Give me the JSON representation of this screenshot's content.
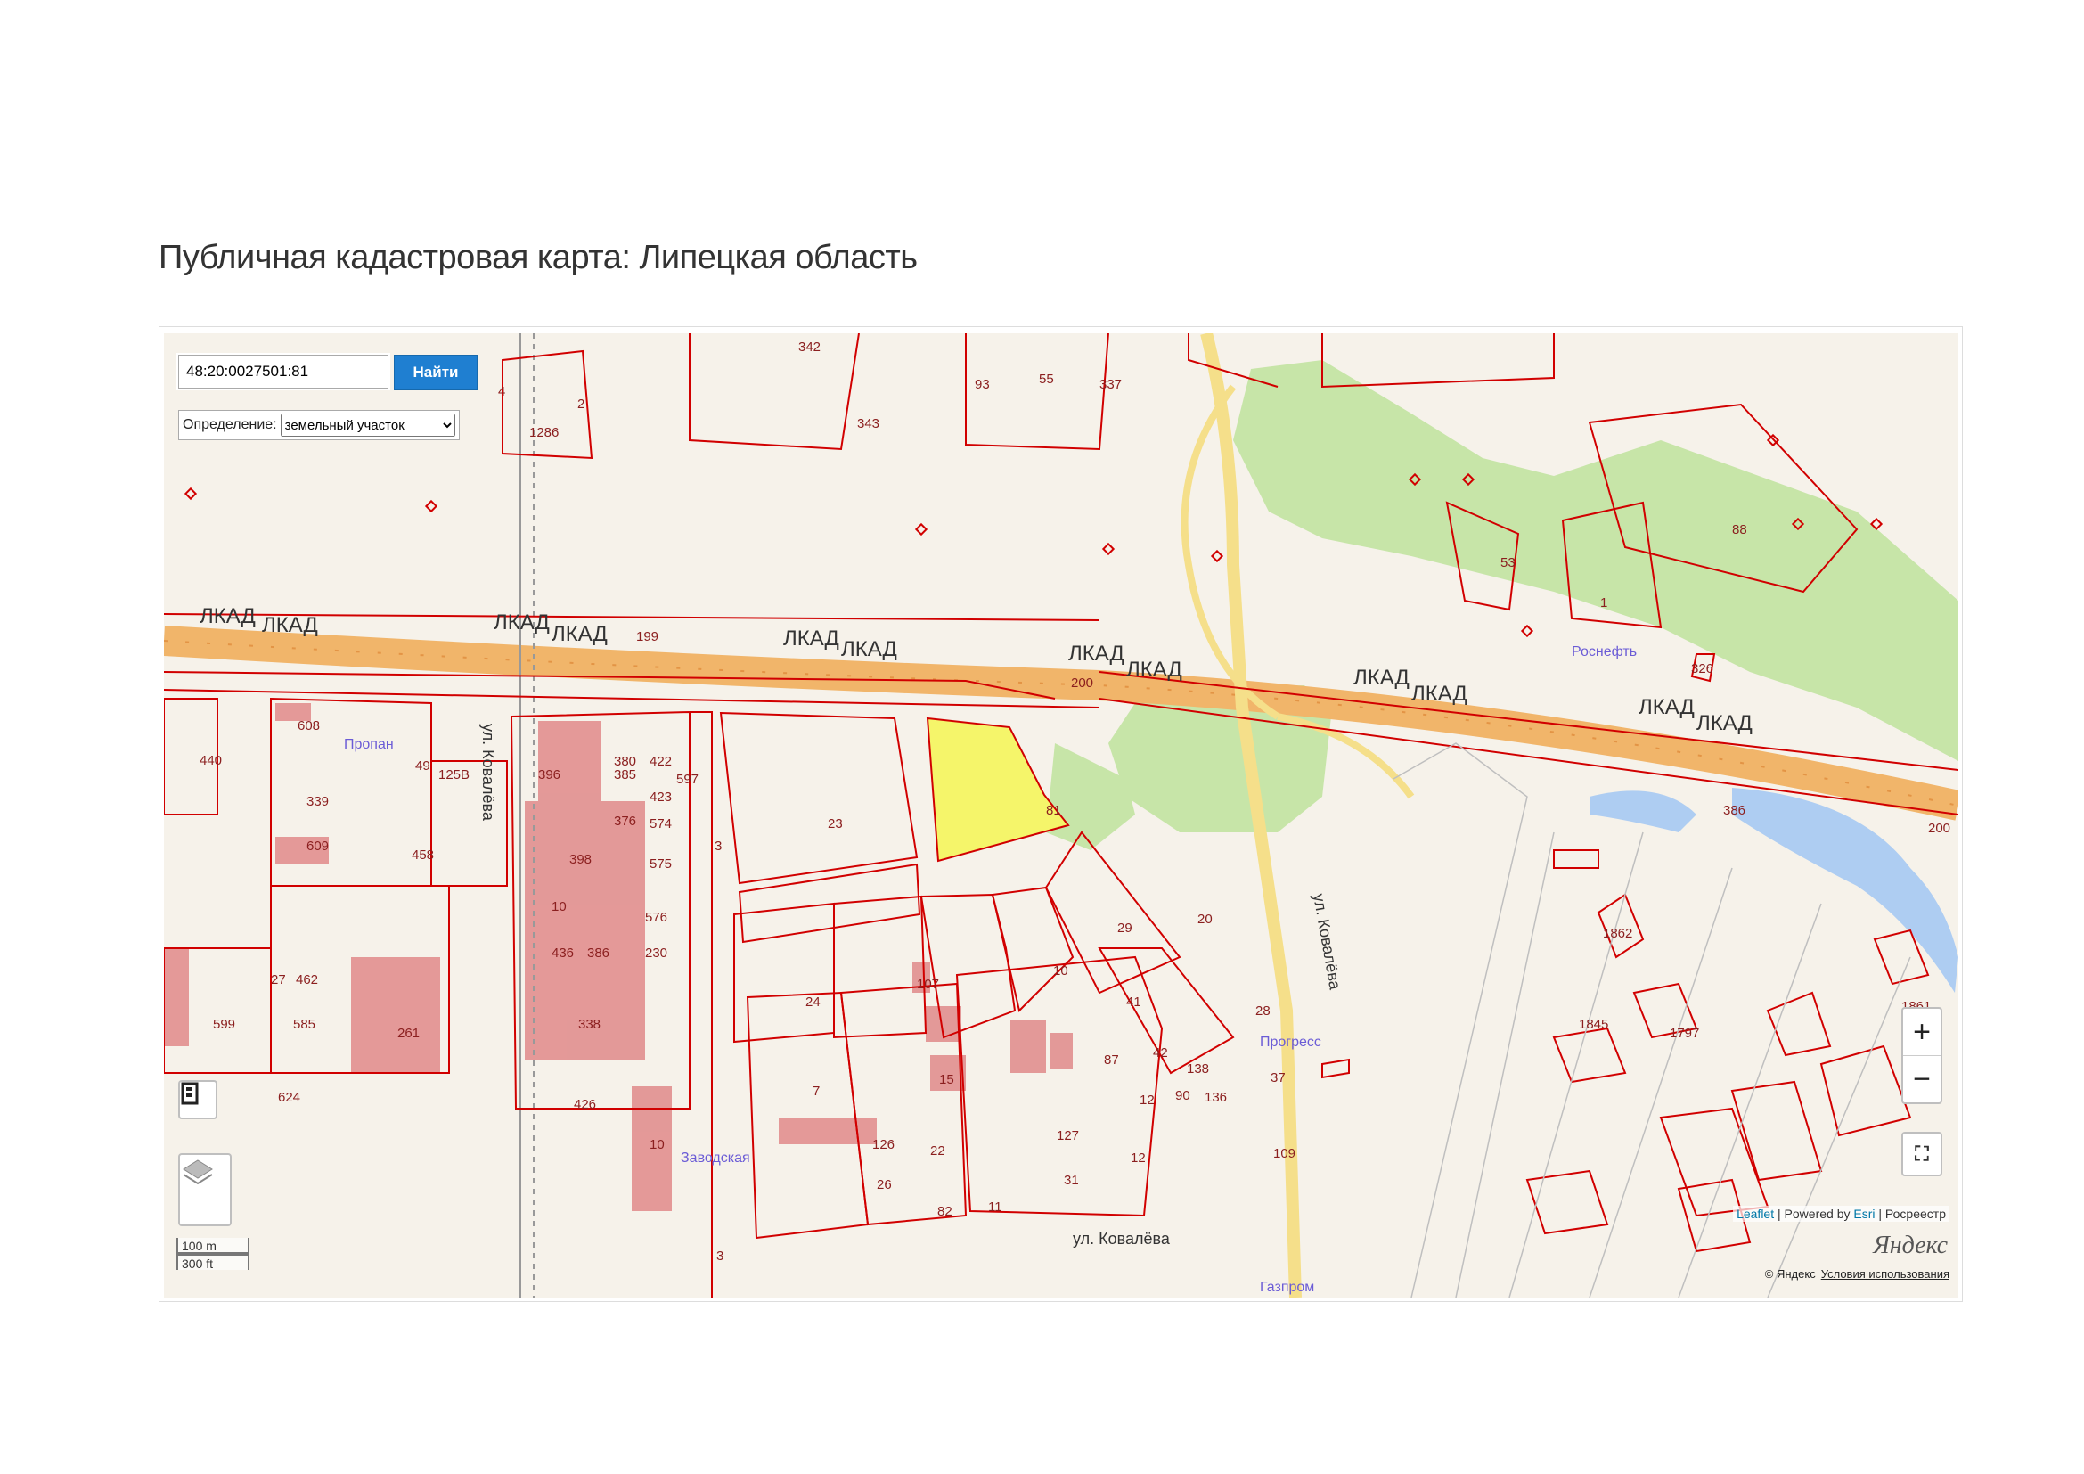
{
  "page": {
    "title": "Публичная кадастровая карта: Липецкая область"
  },
  "search": {
    "value": "48:20:0027501:81",
    "button_label": "Найти"
  },
  "definition": {
    "label": "Определение:",
    "selected": "земельный участок"
  },
  "controls": {
    "zoom_in": "+",
    "zoom_out": "−"
  },
  "scale": {
    "metric": "100 m",
    "imperial": "300 ft"
  },
  "attribution": {
    "leaflet": "Leaflet",
    "powered_by": "Powered by",
    "esri": "Esri",
    "separator": "|",
    "rosreestr": "Росреестр"
  },
  "yandex": {
    "logo": "Яндекс",
    "copyright": "© Яндекс",
    "terms": "Условия использования"
  },
  "map": {
    "highlight_color": "#f5f56a",
    "parcel_color": "#d10000",
    "road_name": "ЛКАД",
    "streets": [
      "ул. Ковалёва",
      "ул. Ковалёва",
      "ул. Ковалёва"
    ],
    "pois": [
      "Пропан",
      "Роснефть",
      "Заводская",
      "Прогресс",
      "Газпром"
    ],
    "parcel_labels": [
      "342",
      "343",
      "55",
      "337",
      "93",
      "2",
      "1286",
      "4",
      "53",
      "88",
      "1",
      "326",
      "199",
      "200",
      "23",
      "81",
      "29",
      "20",
      "10",
      "107",
      "24",
      "41",
      "28",
      "87",
      "42",
      "12",
      "90",
      "138",
      "136",
      "37",
      "15",
      "22",
      "126",
      "26",
      "82",
      "11",
      "7",
      "127",
      "31",
      "12",
      "109",
      "608",
      "440",
      "339",
      "49",
      "125В",
      "609",
      "458",
      "27",
      "462",
      "261",
      "585",
      "599",
      "624",
      "396",
      "380",
      "422",
      "385",
      "423",
      "376",
      "574",
      "398",
      "575",
      "597",
      "3",
      "10",
      "576",
      "436",
      "386",
      "230",
      "338",
      "426",
      "10",
      "3",
      "1862",
      "1845",
      "1797",
      "1861",
      "386",
      "200"
    ]
  }
}
